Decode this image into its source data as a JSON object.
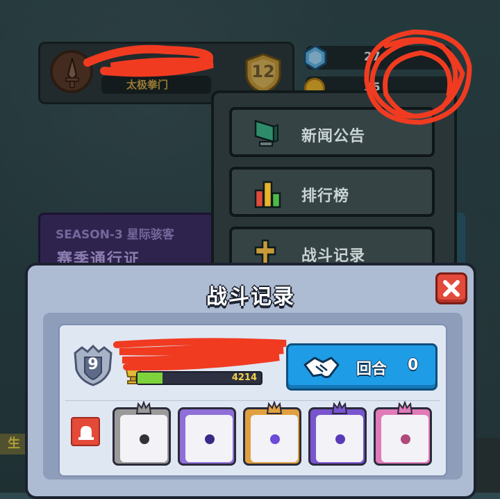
{
  "profile": {
    "subtitle": "太极拳门",
    "level": "12"
  },
  "currency": {
    "gems": "27",
    "coins": "35"
  },
  "menu": {
    "items": [
      {
        "label": "新闻公告",
        "icon": "monitor-icon"
      },
      {
        "label": "排行榜",
        "icon": "leaderboard-icon"
      },
      {
        "label": "战斗记录",
        "icon": "battle-record-icon"
      }
    ]
  },
  "season": {
    "line1": "SEASON-3 星际骇客",
    "line2": "赛季通行证"
  },
  "bottom_left_tab": "生",
  "dialog": {
    "title": "战斗记录",
    "rank": "9",
    "xp_value": "4214",
    "xp_fraction": 0.2,
    "round_label": "回合",
    "round_value": "0",
    "dice": [
      {
        "name": "gray-dice",
        "color": "#9a9a9a",
        "pip": "#333333"
      },
      {
        "name": "purple-storm-dice",
        "color": "#8f6fd8",
        "pip": "#3a2a88"
      },
      {
        "name": "rainbow-dice",
        "color": "#e0a040",
        "pip": "#6b4bd8"
      },
      {
        "name": "violet-dice",
        "color": "#7a55d0",
        "pip": "#5a3ab8"
      },
      {
        "name": "pink-dice",
        "color": "#e07ab8",
        "pip": "#b04a7a"
      }
    ]
  },
  "colors": {
    "accent_blue": "#1e9de6",
    "close_red": "#e24b3b",
    "xp_green": "#7ed23b"
  }
}
